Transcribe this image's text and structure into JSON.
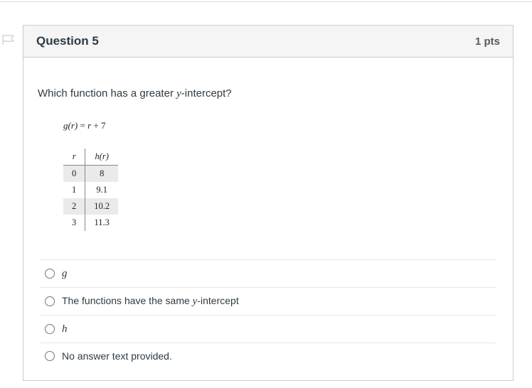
{
  "header": {
    "title": "Question 5",
    "points": "1 pts"
  },
  "prompt": {
    "prefix": "Which function has a greater ",
    "var": "y",
    "suffix": "-intercept?"
  },
  "equation": {
    "lhs_g": "g",
    "lhs_r": "r",
    "eq": " = ",
    "rhs_r": "r",
    "rhs_plus7": " + 7"
  },
  "chart_data": {
    "type": "table",
    "title": "",
    "columns": [
      "r",
      "h(r)"
    ],
    "rows": [
      {
        "r": "0",
        "h": "8"
      },
      {
        "r": "1",
        "h": "9.1"
      },
      {
        "r": "2",
        "h": "10.2"
      },
      {
        "r": "3",
        "h": "11.3"
      }
    ]
  },
  "answers": {
    "a": "g",
    "b_prefix": "The functions have the same ",
    "b_var": "y",
    "b_suffix": "-intercept",
    "c": "h",
    "d": "No answer text provided."
  }
}
